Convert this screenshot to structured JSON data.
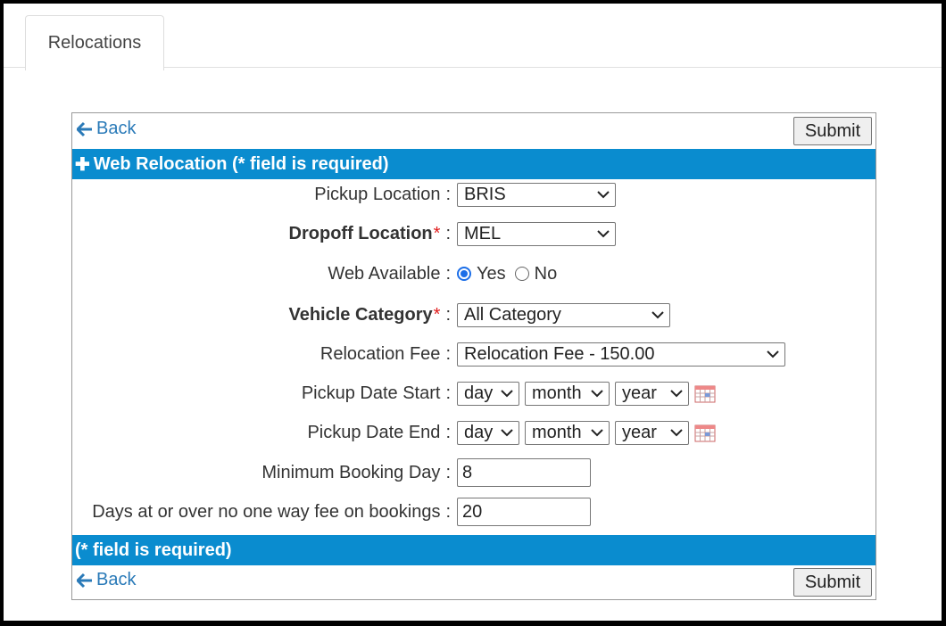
{
  "tabs": [
    {
      "label": "Relocations"
    }
  ],
  "nav": {
    "back_label": "Back",
    "submit_label": "Submit"
  },
  "header_bar": {
    "title": "Web Relocation (* field is required)"
  },
  "footer_bar": {
    "text": "(* field is required)"
  },
  "form": {
    "pickup_location": {
      "label": "Pickup Location",
      "value": "BRIS"
    },
    "dropoff_location": {
      "label": "Dropoff Location",
      "required_mark": "*",
      "value": "MEL"
    },
    "web_available": {
      "label": "Web Available",
      "options": [
        "Yes",
        "No"
      ],
      "selected": "Yes"
    },
    "vehicle_category": {
      "label": "Vehicle Category",
      "required_mark": "*",
      "value": "All Category"
    },
    "relocation_fee": {
      "label": "Relocation Fee",
      "value": "Relocation Fee - 150.00"
    },
    "pickup_date_start": {
      "label": "Pickup Date Start",
      "day": "day",
      "month": "month",
      "year": "year"
    },
    "pickup_date_end": {
      "label": "Pickup Date End",
      "day": "day",
      "month": "month",
      "year": "year"
    },
    "minimum_booking_day": {
      "label": "Minimum Booking Day",
      "value": "8"
    },
    "no_one_way_fee_days": {
      "label": "Days at or over no one way fee on bookings",
      "value": "20"
    },
    "colon": ":"
  },
  "colors": {
    "bar": "#0a8ccf",
    "link": "#2a7ab8",
    "required": "#e01b1b",
    "radio_selected": "#1b6ee8"
  }
}
